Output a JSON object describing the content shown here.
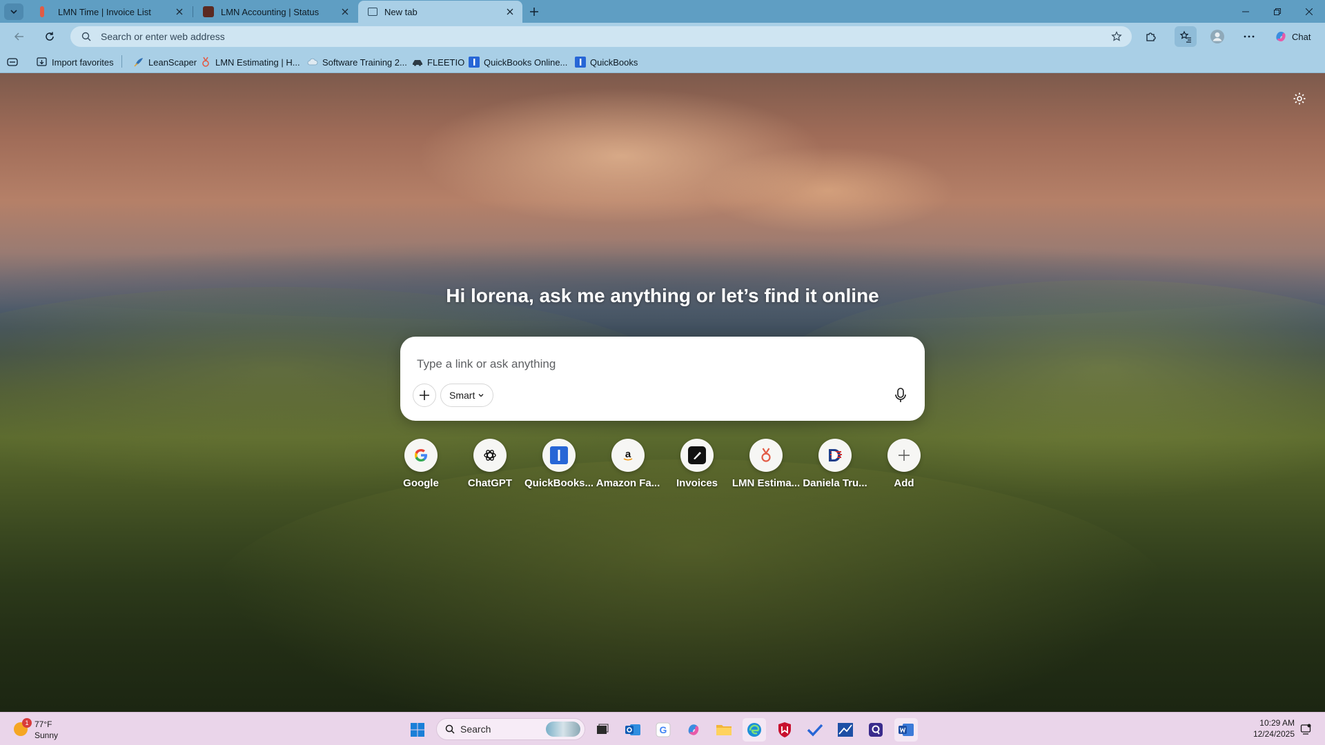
{
  "browser": {
    "tabs": [
      {
        "label": "LMN Time | Invoice List",
        "active": false
      },
      {
        "label": "LMN Accounting | Status",
        "active": false
      },
      {
        "label": "New tab",
        "active": true
      }
    ],
    "address_placeholder": "Search or enter web address",
    "chat_label": "Chat"
  },
  "favorites": [
    {
      "label": "Import favorites",
      "icon": "import-icon"
    },
    {
      "label": "LeanScaper",
      "icon": "leanscaper-icon"
    },
    {
      "label": "LMN Estimating | H...",
      "icon": "lmn-icon"
    },
    {
      "label": "Software Training 2...",
      "icon": "cloud-icon"
    },
    {
      "label": "FLEETIO",
      "icon": "fleetio-icon"
    },
    {
      "label": "QuickBooks Online...",
      "icon": "quickbooks-icon"
    },
    {
      "label": "QuickBooks",
      "icon": "quickbooks-icon"
    }
  ],
  "newtab": {
    "greeting": "Hi lorena, ask me anything or let’s find it online",
    "search_placeholder": "Type a link or ask anything",
    "mode_label": "Smart",
    "shortcuts": [
      {
        "label": "Google",
        "icon": "google-icon"
      },
      {
        "label": "ChatGPT",
        "icon": "chatgpt-icon"
      },
      {
        "label": "QuickBooks...",
        "icon": "quickbooks-icon"
      },
      {
        "label": "Amazon Fa...",
        "icon": "amazon-icon"
      },
      {
        "label": "Invoices",
        "icon": "invoices-icon"
      },
      {
        "label": "LMN Estima...",
        "icon": "lmn-icon"
      },
      {
        "label": "Daniela Tru...",
        "icon": "daniela-icon"
      },
      {
        "label": "Add",
        "icon": "plus-icon"
      }
    ]
  },
  "taskbar": {
    "weather_badge": "1",
    "temperature": "77°F",
    "condition": "Sunny",
    "search_label": "Search",
    "time": "10:29 AM",
    "date": "12/24/2025"
  },
  "colors": {
    "tabbar": "#5f9ec3",
    "toolbar": "#a9cfe6",
    "taskbar": "#ead5ea"
  }
}
